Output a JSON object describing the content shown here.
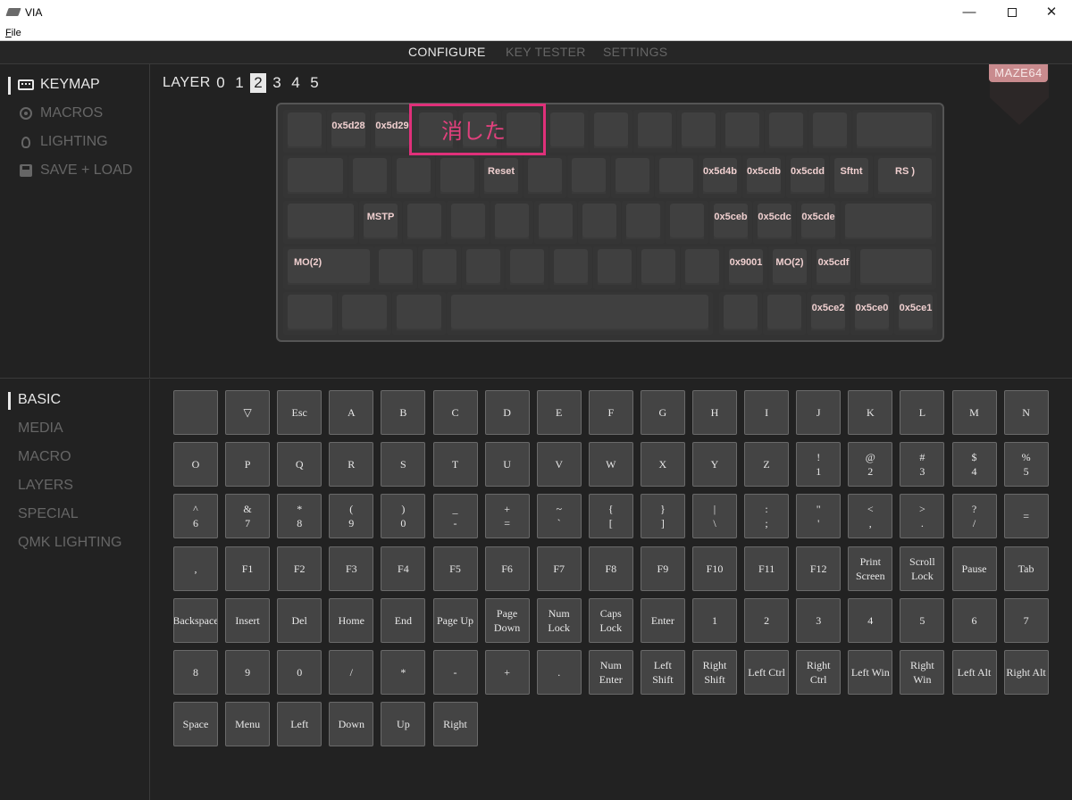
{
  "window": {
    "title": "VIA",
    "menu_file": "File"
  },
  "nav": {
    "tabs": [
      "CONFIGURE",
      "KEY TESTER",
      "SETTINGS"
    ],
    "active": "CONFIGURE"
  },
  "sidebar": {
    "items": [
      {
        "label": "KEYMAP",
        "icon": "keyboard-icon",
        "active": true
      },
      {
        "label": "MACROS",
        "icon": "macro-circle-icon",
        "active": false
      },
      {
        "label": "LIGHTING",
        "icon": "lightbulb-icon",
        "active": false
      },
      {
        "label": "SAVE + LOAD",
        "icon": "save-disk-icon",
        "active": false
      }
    ]
  },
  "categories": {
    "items": [
      "BASIC",
      "MEDIA",
      "MACRO",
      "LAYERS",
      "SPECIAL",
      "QMK LIGHTING"
    ],
    "active": "BASIC"
  },
  "layers": {
    "label": "LAYER",
    "numbers": [
      "0",
      "1",
      "2",
      "3",
      "4",
      "5"
    ],
    "active": "2"
  },
  "device": {
    "name": "MAZE64"
  },
  "colors": {
    "accent": "#e0307a",
    "badge": "#c98b8e",
    "key_label": "#f0d0d0"
  },
  "annotation": {
    "text": "消した"
  },
  "keymap": {
    "row1": [
      "",
      "0x5d28",
      "0x5d29",
      "",
      "",
      "",
      "",
      "",
      "",
      "",
      "",
      "",
      "",
      ""
    ],
    "row2": [
      "",
      "",
      "",
      "",
      "Reset",
      "",
      "",
      "",
      "",
      "0x5d4b",
      "0x5cdb",
      "0x5cdd",
      "Sftnt",
      "RS )"
    ],
    "row3": [
      "",
      "MSTP",
      "",
      "",
      "",
      "",
      "",
      "",
      "",
      "0x5ceb",
      "0x5cdc",
      "0x5cde",
      ""
    ],
    "row4": [
      "MO(2)",
      "",
      "",
      "",
      "",
      "",
      "",
      "",
      "",
      "0x9001",
      "MO(2)",
      "0x5cdf",
      ""
    ],
    "row5": [
      "",
      "",
      "",
      "",
      "",
      "",
      "0x5ce2",
      "0x5ce0",
      "0x5ce1"
    ]
  },
  "palette": {
    "rows": [
      [
        "",
        "▽",
        "Esc",
        "A",
        "B",
        "C",
        "D",
        "E",
        "F",
        "G",
        "H",
        "I",
        "J",
        "K",
        "L",
        "M",
        "N"
      ],
      [
        "O",
        "P",
        "Q",
        "R",
        "S",
        "T",
        "U",
        "V",
        "W",
        "X",
        "Y",
        "Z",
        "!\n1",
        "@\n2",
        "#\n3",
        "$\n4",
        "%\n5"
      ],
      [
        "^\n6",
        "&\n7",
        "*\n8",
        "(\n9",
        ")\n0",
        "_\n-",
        "+\n=",
        "~\n`",
        "{\n[",
        "}\n]",
        "|\n\\",
        ":\n;",
        "\"\n'",
        "<\n,",
        ">\n.",
        "?\n/",
        "="
      ],
      [
        ",",
        "F1",
        "F2",
        "F3",
        "F4",
        "F5",
        "F6",
        "F7",
        "F8",
        "F9",
        "F10",
        "F11",
        "F12",
        "Print\nScreen",
        "Scroll\nLock",
        "Pause",
        "Tab"
      ],
      [
        "Backspace",
        "Insert",
        "Del",
        "Home",
        "End",
        "Page Up",
        "Page\nDown",
        "Num\nLock",
        "Caps\nLock",
        "Enter",
        "1",
        "2",
        "3",
        "4",
        "5",
        "6",
        "7"
      ],
      [
        "8",
        "9",
        "0",
        "/",
        "*",
        "-",
        "+",
        ".",
        "Num\nEnter",
        "Left\nShift",
        "Right\nShift",
        "Left Ctrl",
        "Right\nCtrl",
        "Left Win",
        "Right\nWin",
        "Left Alt",
        "Right Alt"
      ],
      [
        "Space",
        "Menu",
        "Left",
        "Down",
        "Up",
        "Right"
      ]
    ]
  }
}
